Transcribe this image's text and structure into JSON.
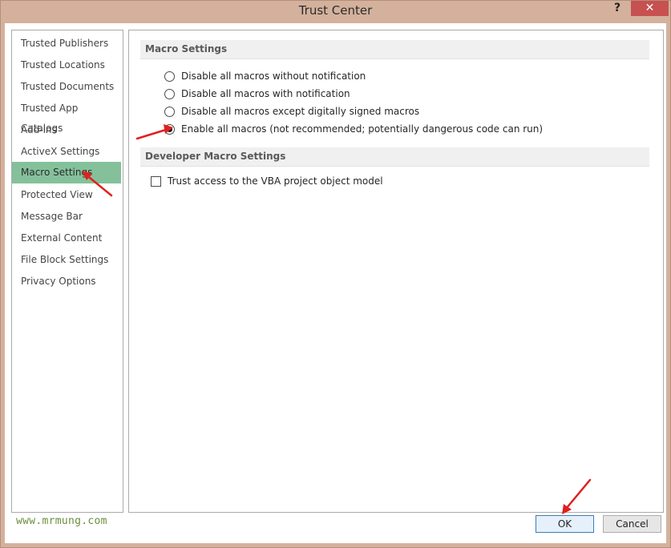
{
  "window": {
    "title": "Trust Center",
    "help_label": "?",
    "close_label": "✕"
  },
  "sidebar": {
    "items": [
      {
        "label": "Trusted Publishers"
      },
      {
        "label": "Trusted Locations"
      },
      {
        "label": "Trusted Documents"
      },
      {
        "label": "Trusted App Catalogs"
      },
      {
        "label": "Add-ins"
      },
      {
        "label": "ActiveX Settings"
      },
      {
        "label": "Macro Settings",
        "selected": true
      },
      {
        "label": "Protected View"
      },
      {
        "label": "Message Bar"
      },
      {
        "label": "External Content"
      },
      {
        "label": "File Block Settings"
      },
      {
        "label": "Privacy Options"
      }
    ]
  },
  "macro_settings": {
    "header": "Macro Settings",
    "options": [
      {
        "label": "Disable all macros without notification",
        "checked": false
      },
      {
        "label": "Disable all macros with notification",
        "checked": false
      },
      {
        "label": "Disable all macros except digitally signed macros",
        "checked": false
      },
      {
        "label": "Enable all macros (not recommended; potentially dangerous code can run)",
        "checked": true
      }
    ]
  },
  "developer_settings": {
    "header": "Developer Macro Settings",
    "trust_vba_label": "Trust access to the VBA project object model",
    "trust_vba_checked": false
  },
  "footer": {
    "watermark": "www.mrmung.com",
    "ok_label": "OK",
    "cancel_label": "Cancel"
  },
  "colors": {
    "selected_nav": "#84c19a",
    "annotation_arrow": "#e0201e"
  }
}
